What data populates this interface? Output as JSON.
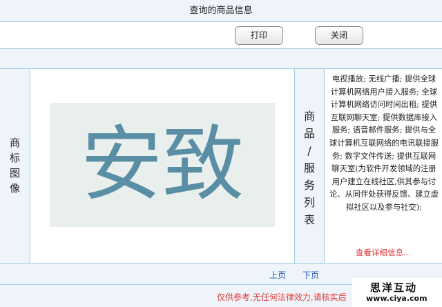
{
  "header": {
    "title": "查询的商品信息"
  },
  "toolbar": {
    "print_label": "打印",
    "close_label": "关闭"
  },
  "trademark": {
    "label_chars": [
      "商",
      "标",
      "图",
      "像"
    ],
    "mark_text": "安致",
    "ink_color": "#5a8ea5"
  },
  "goods": {
    "label_chars": [
      "商",
      "品",
      "/",
      "服",
      "务",
      "列",
      "表"
    ],
    "text": "电视播放; 无线广播; 提供全球计算机网络用户接入服务; 全球计算机网络访问时间出租; 提供互联网聊天室; 提供数据库接入服务; 语音邮件服务; 提供与全球计算机互联网络的电讯联接服务; 数字文件传送; 提供互联网聊天室(为软件开发领域的注册用户建立在线社区,供其参与讨论、从同伴处获得反馈、建立虚拟社区以及参与社交);",
    "detail_link": "查看详细信息..."
  },
  "pager": {
    "prev": "上页",
    "next": "下页"
  },
  "footer": {
    "disclaimer": "仅供参考,无任何法律效力,请核实后"
  },
  "watermark": {
    "title": "思洋互动",
    "url": "www.ciya.com"
  },
  "colors": {
    "border": "#9ecfe0",
    "band": "#eef4fa",
    "link": "#2a5dc4",
    "alert": "#e23a3a"
  }
}
